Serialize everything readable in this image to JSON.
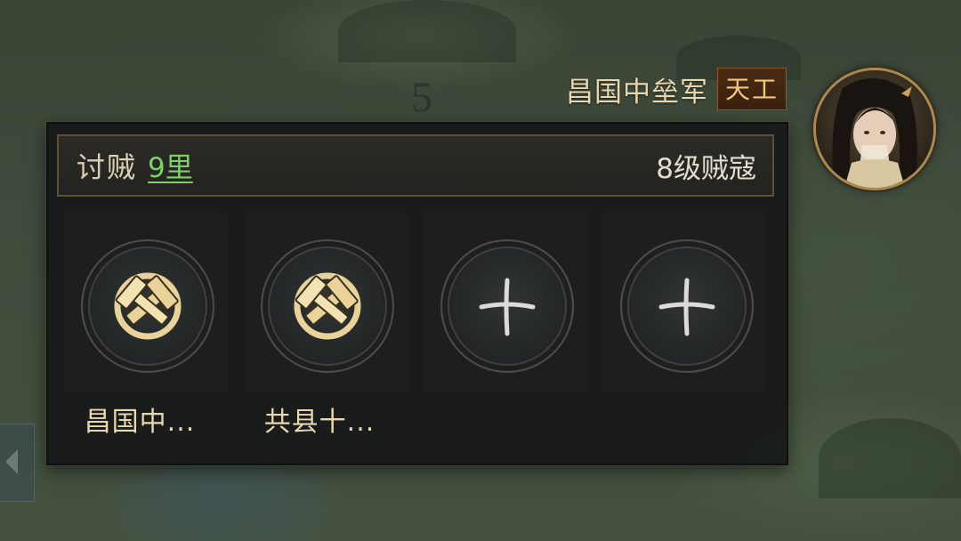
{
  "map": {
    "tile_number_top": "5",
    "tile_number_left": "5"
  },
  "army": {
    "name": "昌国中垒军",
    "badge": "天工",
    "badge_color": "#f1c77d"
  },
  "march": {
    "action_label": "讨贼",
    "distance": "9里",
    "distance_color": "#7fcf6a",
    "target": "8级贼寇"
  },
  "slots": [
    {
      "state": "filled",
      "icon": "crossed-hammers-icon",
      "label": "昌国中..."
    },
    {
      "state": "filled",
      "icon": "crossed-hammers-icon",
      "label": "共县十..."
    },
    {
      "state": "empty",
      "icon": "plus-icon",
      "label": ""
    },
    {
      "state": "empty",
      "icon": "plus-icon",
      "label": ""
    }
  ],
  "colors": {
    "panel_bg": "#161818",
    "border_gold": "#5c5035",
    "icon_gold": "#e9d39a"
  }
}
